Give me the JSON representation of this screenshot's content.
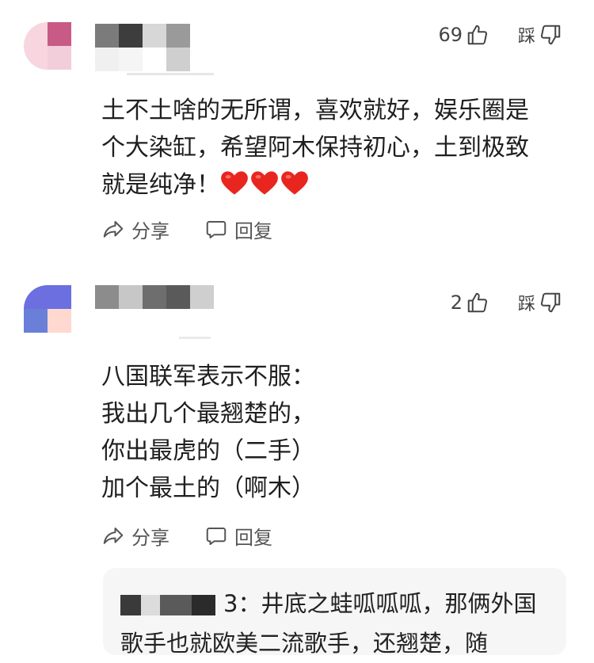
{
  "comments": [
    {
      "likes": "69",
      "dislike_label": "踩",
      "text": "土不土啥的无所谓，喜欢就好，娱乐圈是\n个大染缸，希望阿木保持初心，土到极致\n就是纯净！",
      "share_label": "分享",
      "reply_label": "回复"
    },
    {
      "likes": "2",
      "dislike_label": "踩",
      "text": "八国联军表示不服：\n我出几个最翘楚的，\n你出最虎的（二手）\n加个最土的（啊木）",
      "share_label": "分享",
      "reply_label": "回复"
    }
  ],
  "reply_preview": {
    "name_fragment": "3：",
    "text": "井底之蛙呱呱呱，那俩外国歌手也就欧美二流歌手，还翘楚，随"
  },
  "colors": {
    "heart": "#e8261f",
    "text": "#1f1f1f",
    "icon": "#555555"
  },
  "icons": {
    "like": "thumbs-up-icon",
    "dislike": "thumbs-down-icon",
    "share": "share-arrow-icon",
    "reply": "speech-bubble-icon",
    "emoji": "red-heart-icon"
  }
}
